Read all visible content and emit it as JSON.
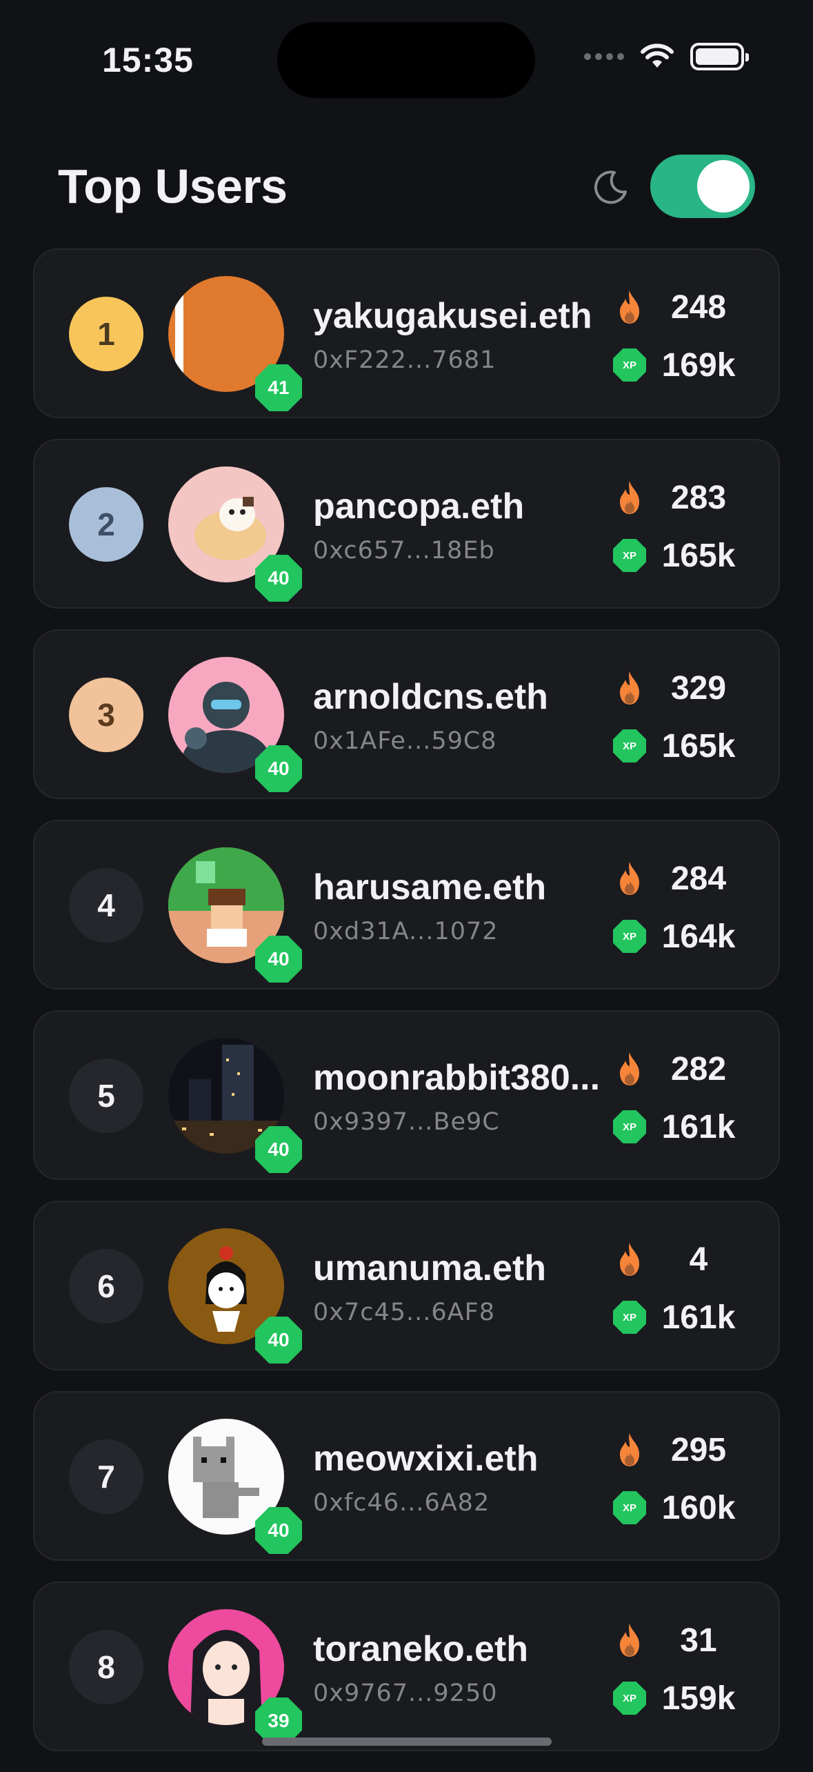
{
  "status_bar": {
    "time": "15:35"
  },
  "header": {
    "title": "Top Users",
    "theme_icon": "moon-icon",
    "dark_mode_on": true,
    "toggle_color": "#29b586"
  },
  "rank_colors": {
    "1": "#f8c55a",
    "2": "#a9bfd9",
    "3": "#f2c29a",
    "default": "#26272c"
  },
  "users": [
    {
      "rank": "1",
      "name": "yakugakusei.eth",
      "address": "0xF222...7681",
      "level": "41",
      "streak": "248",
      "xp": "169k"
    },
    {
      "rank": "2",
      "name": "pancopa.eth",
      "address": "0xc657...18Eb",
      "level": "40",
      "streak": "283",
      "xp": "165k"
    },
    {
      "rank": "3",
      "name": "arnoldcns.eth",
      "address": "0x1AFe...59C8",
      "level": "40",
      "streak": "329",
      "xp": "165k"
    },
    {
      "rank": "4",
      "name": "harusame.eth",
      "address": "0xd31A...1072",
      "level": "40",
      "streak": "284",
      "xp": "164k"
    },
    {
      "rank": "5",
      "name": "moonrabbit380...",
      "address": "0x9397...Be9C",
      "level": "40",
      "streak": "282",
      "xp": "161k"
    },
    {
      "rank": "6",
      "name": "umanuma.eth",
      "address": "0x7c45...6AF8",
      "level": "40",
      "streak": "4",
      "xp": "161k"
    },
    {
      "rank": "7",
      "name": "meowxixi.eth",
      "address": "0xfc46...6A82",
      "level": "40",
      "streak": "295",
      "xp": "160k"
    },
    {
      "rank": "8",
      "name": "toraneko.eth",
      "address": "0x9767...9250",
      "level": "39",
      "streak": "31",
      "xp": "159k"
    }
  ],
  "xp_badge_label": "XP"
}
